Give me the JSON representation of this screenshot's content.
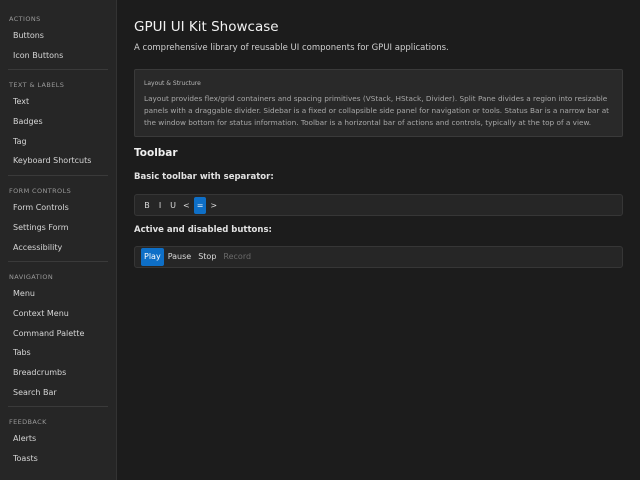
{
  "sidebar": {
    "sections": [
      {
        "title": "ACTIONS",
        "items": [
          "Buttons",
          "Icon Buttons"
        ]
      },
      {
        "title": "TEXT & LABELS",
        "items": [
          "Text",
          "Badges",
          "Tag",
          "Keyboard Shortcuts"
        ]
      },
      {
        "title": "FORM CONTROLS",
        "items": [
          "Form Controls",
          "Settings Form",
          "Accessibility"
        ]
      },
      {
        "title": "NAVIGATION",
        "items": [
          "Menu",
          "Context Menu",
          "Command Palette",
          "Tabs",
          "Breadcrumbs",
          "Search Bar"
        ]
      },
      {
        "title": "FEEDBACK",
        "items": [
          "Alerts",
          "Toasts"
        ]
      }
    ]
  },
  "main": {
    "title": "GPUI UI Kit Showcase",
    "subtitle": "A comprehensive library of reusable UI components for GPUI applications.",
    "info_card": {
      "title": "Layout & Structure",
      "body": "Layout provides flex/grid containers and spacing primitives (VStack, HStack, Divider). Split Pane divides a region into resizable panels with a draggable divider. Sidebar is a fixed or collapsible side panel for navigation or tools. Status Bar is a narrow bar at the window bottom for status information. Toolbar is a horizontal bar of actions and controls, typically at the top of a view."
    },
    "section_heading": "Toolbar",
    "basic_label": "Basic toolbar with separator:",
    "basic_toolbar": {
      "bold": "B",
      "italic": "I",
      "underline": "U",
      "prev": "<",
      "equals": "=",
      "next": ">"
    },
    "states_label": "Active and disabled buttons:",
    "states_toolbar": {
      "play": "Play",
      "pause": "Pause",
      "stop": "Stop",
      "record": "Record"
    }
  },
  "colors": {
    "accent": "#0e6fc7",
    "background": "#1c1c1c",
    "sidebar": "#262626"
  }
}
